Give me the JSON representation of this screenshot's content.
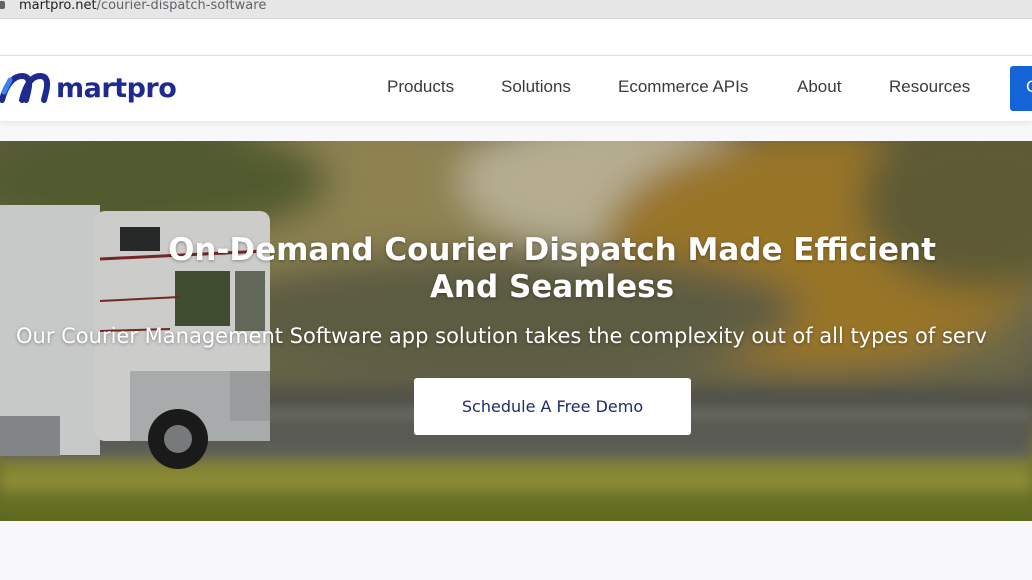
{
  "browser": {
    "url_host": "martpro.net",
    "url_path": "/courier-dispatch-software"
  },
  "header": {
    "logo_text": "martpro",
    "nav": [
      "Products",
      "Solutions",
      "Ecommerce APIs",
      "About",
      "Resources"
    ],
    "cta_label": "C"
  },
  "hero": {
    "title_line1": "On-Demand Courier Dispatch Made Efficient",
    "title_line2": "And Seamless",
    "subtitle": "Our Courier Management Software app solution takes the complexity out of all types of serv",
    "button_label": "Schedule A Free Demo"
  },
  "colors": {
    "brand": "#1f2a8f",
    "cta": "#1565d8",
    "button_text": "#1f2a6f"
  }
}
